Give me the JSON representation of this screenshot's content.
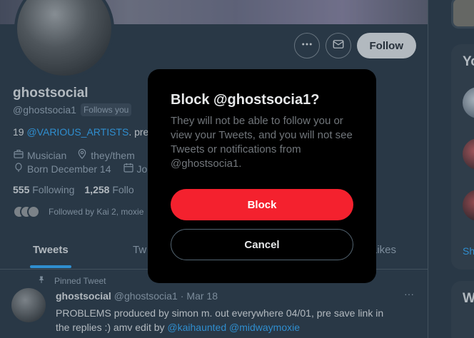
{
  "profile": {
    "name": "ghostsocial",
    "handle": "@ghostsocia1",
    "follows_you_badge": "Follows you",
    "bio_prefix": "19 ",
    "bio_mention": "@VARIOUS_ARTISTS",
    "bio_suffix": ". pre",
    "category": "Musician",
    "pronouns": "they/them",
    "born": "Born December 14",
    "joined_partial": "Jo",
    "following_count": "555",
    "following_label": "Following",
    "followers_count": "1,258",
    "followers_label_partial": "Follo",
    "followed_by_text": "Followed by Kai 2, moxie"
  },
  "actions": {
    "more_icon": "more-horizontal-icon",
    "message_icon": "envelope-icon",
    "follow_label": "Follow"
  },
  "tabs": [
    {
      "label": "Tweets",
      "active": true
    },
    {
      "label": "Tw",
      "active": false
    },
    {
      "label": "Likes",
      "active": false
    }
  ],
  "pinned_tweet": {
    "pinned_label": "Pinned Tweet",
    "author_name": "ghostsocial",
    "author_handle": "@ghostsocia1",
    "separator": "·",
    "date": "Mar 18",
    "more": "···",
    "text_line1": "PROBLEMS produced by simon m. out everywhere 04/01, pre save link in",
    "text_line2_prefix": "the replies :) amv edit by ",
    "mention1": "@kaihaunted",
    "mention2": "@midwaymoxie"
  },
  "right_column": {
    "box_title_partial": "Yo",
    "show_more_partial": "Sh",
    "box2_title_partial": "W"
  },
  "dialog": {
    "title": "Block @ghostsocia1?",
    "body": "They will not be able to follow you or view your Tweets, and you will not see Tweets or notifications from @ghostsocia1.",
    "block_label": "Block",
    "cancel_label": "Cancel"
  },
  "colors": {
    "background": "#15202b",
    "accent": "#1d9bf0",
    "danger": "#f4212e"
  }
}
